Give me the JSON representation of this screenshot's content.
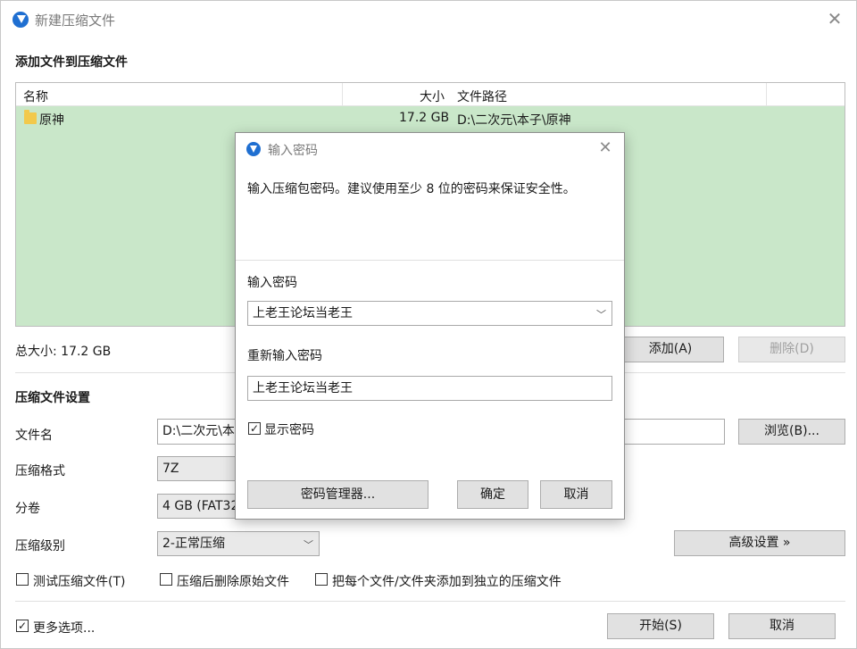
{
  "window": {
    "title": "新建压缩文件"
  },
  "add_section": {
    "heading": "添加文件到压缩文件",
    "columns": [
      "名称",
      "大小",
      "文件路径"
    ],
    "rows": [
      {
        "name": "原神",
        "size": "17.2 GB",
        "path": "D:\\二次元\\本子\\原神"
      }
    ],
    "total_size": "总大小: 17.2 GB",
    "add_button": "添加(A)",
    "delete_button": "删除(D)"
  },
  "settings": {
    "heading": "压缩文件设置",
    "filename_label": "文件名",
    "filename_value": "D:\\二次元\\本",
    "browse_button": "浏览(B)...",
    "format_label": "压缩格式",
    "format_value": "7Z",
    "volume_label": "分卷",
    "volume_value": "4 GB (FAT32",
    "level_label": "压缩级别",
    "level_value": "2-正常压缩",
    "advanced_button": "高级设置 »",
    "test_checkbox": "测试压缩文件(T)",
    "delete_after_checkbox": "压缩后删除原始文件",
    "each_separate_checkbox": "把每个文件/文件夹添加到独立的压缩文件",
    "more_options_checkbox": "更多选项...",
    "start_button": "开始(S)",
    "cancel_button": "取消"
  },
  "password_dialog": {
    "title": "输入密码",
    "description": "输入压缩包密码。建议使用至少 8 位的密码来保证安全性。",
    "password_label": "输入密码",
    "password_value": "上老王论坛当老王",
    "confirm_label": "重新输入密码",
    "confirm_value": "上老王论坛当老王",
    "show_password_checkbox": "显示密码",
    "show_password_checked": "☑",
    "manager_button": "密码管理器...",
    "ok_button": "确定",
    "cancel_button": "取消"
  },
  "colors": {
    "selection_row": "#c9e7c9",
    "accent": "#1f6fd1"
  },
  "icons": {
    "app": "app-logo-icon",
    "close": "close-icon",
    "folder": "folder-icon",
    "dropdown": "chevron-down-icon"
  }
}
